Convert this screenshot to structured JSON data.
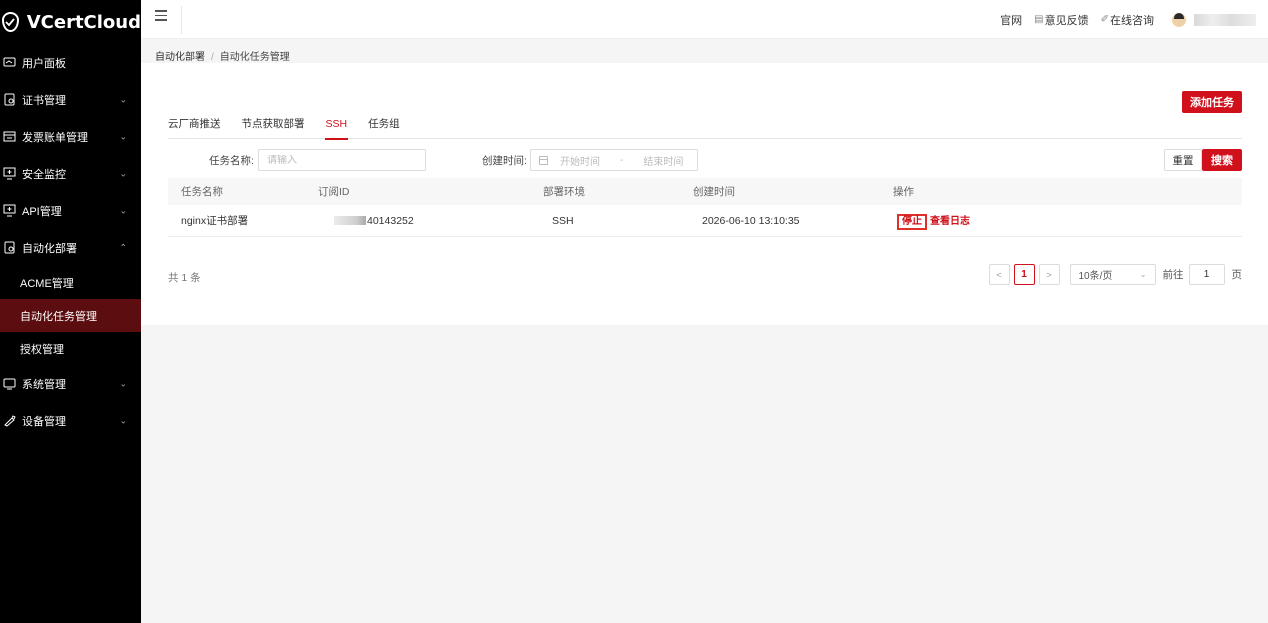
{
  "brand": {
    "name": "VCertCloud"
  },
  "sidebar": {
    "items": [
      {
        "label": "用户面板",
        "icon": "dashboard-icon"
      },
      {
        "label": "证书管理",
        "icon": "certificate-icon",
        "expandable": true
      },
      {
        "label": "发票账单管理",
        "icon": "invoice-icon",
        "expandable": true
      },
      {
        "label": "安全监控",
        "icon": "monitor-icon",
        "expandable": true
      },
      {
        "label": "API管理",
        "icon": "api-icon",
        "expandable": true
      },
      {
        "label": "自动化部署",
        "icon": "deploy-icon",
        "expandable": true,
        "expanded": true
      },
      {
        "label": "系统管理",
        "icon": "system-icon",
        "expandable": true
      },
      {
        "label": "设备管理",
        "icon": "device-icon",
        "expandable": true
      }
    ],
    "subitems": [
      {
        "label": "ACME管理"
      },
      {
        "label": "自动化任务管理",
        "active": true
      },
      {
        "label": "授权管理"
      }
    ]
  },
  "topbar": {
    "links": [
      "官网",
      "意见反馈",
      "在线咨询"
    ]
  },
  "breadcrumb": {
    "parent": "自动化部署",
    "separator": "/",
    "current": "自动化任务管理"
  },
  "actions": {
    "add_task": "添加任务"
  },
  "tabs": [
    "云厂商推送",
    "节点获取部署",
    "SSH",
    "任务组"
  ],
  "active_tab": "SSH",
  "filters": {
    "task_name_label": "任务名称:",
    "task_name_placeholder": "请输入",
    "created_time_label": "创建时间:",
    "start_placeholder": "开始时间",
    "range_separator": "-",
    "end_placeholder": "结束时间",
    "reset": "重置",
    "search": "搜索"
  },
  "table": {
    "columns": [
      "任务名称",
      "订阅ID",
      "部署环境",
      "创建时间",
      "操作"
    ],
    "rows": [
      {
        "name": "nginx证书部署",
        "subscription_id_visible": "40143252",
        "env": "SSH",
        "created": "2026-06-10 13:10:35",
        "op_stop": "停止",
        "op_log": "查看日志"
      }
    ]
  },
  "pagination": {
    "total": "共 1 条",
    "current_page": "1",
    "page_size": "10条/页",
    "goto_label": "前往",
    "goto_value": "1",
    "goto_unit": "页"
  },
  "colors": {
    "accent": "#d0101b",
    "sidebar_bg": "#000000",
    "sidebar_active": "#5b0d10"
  }
}
